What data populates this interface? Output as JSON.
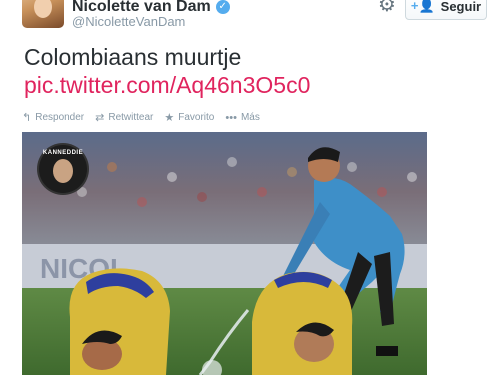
{
  "profile": {
    "name": "Nicolette van Dam",
    "handle": "@NicoletteVanDam",
    "verified_icon": "verified-badge-icon"
  },
  "header": {
    "settings_icon": "gear-icon",
    "follow_label": "Seguir",
    "follow_icon": "add-user-icon"
  },
  "tweet": {
    "text": "Colombiaans muurtje",
    "link": "pic.twitter.com/Aq46n3O5c0"
  },
  "actions": [
    {
      "label": "Responder",
      "icon": "reply-icon"
    },
    {
      "label": "Retwittear",
      "icon": "retweet-icon"
    },
    {
      "label": "Favorito",
      "icon": "star-icon"
    },
    {
      "label": "Más",
      "icon": "more-icon"
    }
  ],
  "media": {
    "badge_text": "KANNEDDIE",
    "banner_text": "NICOL",
    "colors": {
      "pitch": "#4f7a3a",
      "jersey": "#d8b93a",
      "collar": "#2e3f9e",
      "referee": "#3e8fc8",
      "link": "#e0245e"
    }
  }
}
